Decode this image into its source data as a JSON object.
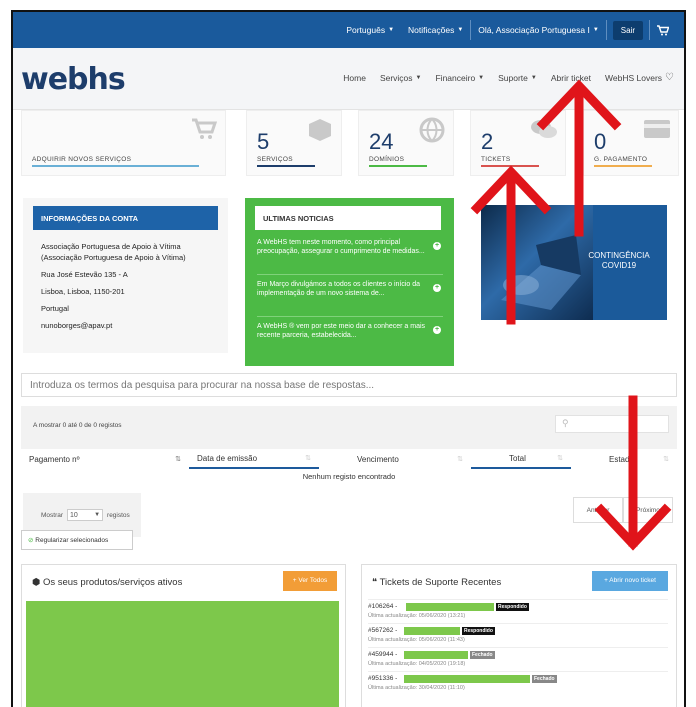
{
  "topbar": {
    "language": "Português",
    "notifications": "Notificações",
    "greeting": "Olá, Associação Portuguesa I",
    "logout": "Sair",
    "cart_icon": "cart-icon"
  },
  "header": {
    "logo": "webhs",
    "nav": [
      {
        "label": "Home"
      },
      {
        "label": "Serviços"
      },
      {
        "label": "Financeiro"
      },
      {
        "label": "Suporte"
      },
      {
        "label": "Abrir ticket"
      },
      {
        "label": "WebHS Lovers"
      }
    ]
  },
  "stats": [
    {
      "number": "",
      "label": "ADQUIRIR NOVOS SERVIÇOS",
      "icon": "cart-icon",
      "color": "#6ab0d6"
    },
    {
      "number": "5",
      "label": "SERVIÇOS",
      "icon": "box-icon",
      "color": "#1d3d6b"
    },
    {
      "number": "24",
      "label": "DOMÍNIOS",
      "icon": "globe-icon",
      "color": "#4cba45"
    },
    {
      "number": "2",
      "label": "TICKETS",
      "icon": "chat-icon",
      "color": "#d9534f"
    },
    {
      "number": "0",
      "label": "G. PAGAMENTO",
      "icon": "card-icon",
      "color": "#f0ad4e"
    }
  ],
  "account": {
    "title": "INFORMAÇÕES DA CONTA",
    "name": "Associação Portuguesa de Apoio à Vítima",
    "name2": "(Associação Portuguesa de Apoio à Vítima)",
    "address": "Rua José Estevão 135 - A",
    "city": "Lisboa, Lisboa, 1150-201",
    "country": "Portugal",
    "email": "nunoborges@apav.pt"
  },
  "news": {
    "title": "ULTIMAS NOTICIAS",
    "items": [
      {
        "text": "A WebHS tem neste momento, como principal preocupação, assegurar o cumprimento de medidas..."
      },
      {
        "text": "Em Março divulgámos a todos os clientes o início da implementação de um novo sistema de..."
      },
      {
        "text": "A WebHS ® vem por este meio dar a conhecer a mais recente parceria, estabelecida..."
      }
    ]
  },
  "covid": {
    "text": "CONTINGÊNCIA COVID19"
  },
  "search": {
    "placeholder": "Introduza os termos da pesquisa para procurar na nossa base de respostas..."
  },
  "table": {
    "showing": "A mostrar 0 até 0 de 0 registos",
    "columns": [
      "Pagamento nº",
      "Data de emissão",
      "Vencimento",
      "Total",
      "Estado"
    ],
    "empty": "Nenhum registo encontrado",
    "show_label": "Mostrar",
    "show_value": "10",
    "records_label": "registos",
    "regularize": "Regularizar selecionados",
    "prev": "Anterior",
    "next": "Próximo"
  },
  "products": {
    "title": "Os seus produtos/serviços ativos",
    "button": "+ Ver Todos"
  },
  "tickets": {
    "title": "Tickets de Suporte Recentes",
    "button": "+ Abrir novo ticket",
    "rows": [
      {
        "id": "#106264 -",
        "status": "Respondido",
        "status_color": "#111",
        "updated": "Última actualização: 05/06/2020 (13:21)"
      },
      {
        "id": "#567262 -",
        "status": "Respondido",
        "status_color": "#111",
        "updated": "Última actualização: 05/06/2020 (11:43)"
      },
      {
        "id": "#459944 -",
        "status": "Fechado",
        "status_color": "#888",
        "updated": "Última actualização: 04/05/2020 (19:18)"
      },
      {
        "id": "#951336 -",
        "status": "Fechado",
        "status_color": "#888",
        "updated": "Última actualização: 30/04/2020 (11:10)"
      }
    ]
  },
  "colors": {
    "brand_blue": "#1a5a9c",
    "green": "#4cba45",
    "annotation_red": "#e0141a"
  }
}
